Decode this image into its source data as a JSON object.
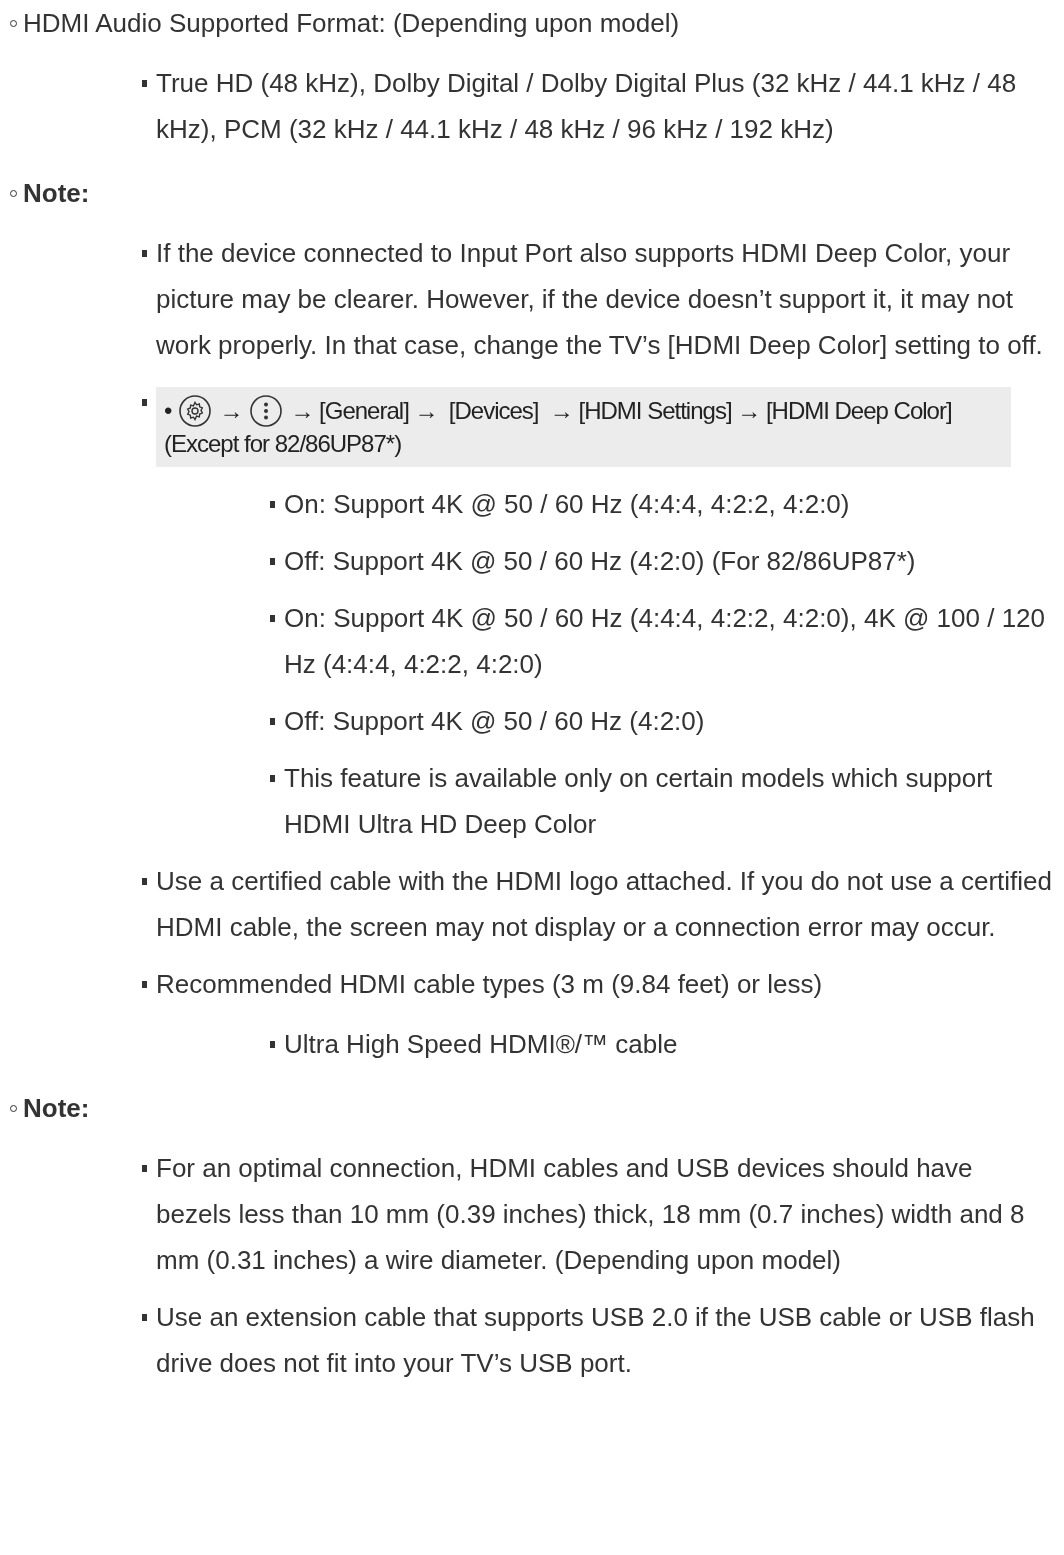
{
  "items": [
    {
      "kind": "text",
      "text": "HDMI Audio Supported Format: (Depending upon model)",
      "children": [
        {
          "kind": "text",
          "text": "True HD (48 kHz), Dolby Digital / Dolby Digital Plus (32 kHz / 44.1 kHz / 48 kHz), PCM (32 kHz / 44.1 kHz / 48 kHz / 96 kHz / 192 kHz)"
        }
      ]
    },
    {
      "kind": "note",
      "text": "Note:",
      "children": [
        {
          "kind": "text",
          "text": "If the device connected to Input Port also supports HDMI Deep Color, your picture may be clearer. However, if the device doesn’t support it, it may not work properly. In that case, change the TV’s [HDMI Deep Color] setting to off."
        },
        {
          "kind": "image",
          "segments": [
            {
              "kind": "text",
              "text": "•"
            },
            {
              "kind": "gear"
            },
            {
              "kind": "text",
              "text": "→"
            },
            {
              "kind": "menu"
            },
            {
              "kind": "text",
              "text": "→ [General] →  [Devices]  → [HDMI Settings] → [HDMI Deep Color]"
            }
          ],
          "caption": "(Except for 82/86UP87*)",
          "children": [
            {
              "kind": "text",
              "text": "On: Support 4K @ 50 / 60 Hz (4:4:4, 4:2:2, 4:2:0)"
            },
            {
              "kind": "text",
              "text": "Off: Support 4K @ 50 / 60 Hz (4:2:0) (For 82/86UP87*)"
            },
            {
              "kind": "text",
              "text": "On: Support 4K @ 50 / 60 Hz (4:4:4, 4:2:2, 4:2:0), 4K @ 100 / 120 Hz (4:4:4, 4:2:2, 4:2:0)"
            },
            {
              "kind": "text",
              "text": "Off: Support 4K @ 50 / 60 Hz (4:2:0)"
            },
            {
              "kind": "text",
              "text": "This feature is available only on certain models which support HDMI Ultra HD Deep Color"
            }
          ]
        },
        {
          "kind": "text",
          "text": "Use a certified cable with the HDMI logo attached. If you do not use a certified HDMI cable, the screen may not display or a connection error may occur."
        },
        {
          "kind": "text",
          "text": "Recommended HDMI cable types (3 m (9.84 feet) or less)",
          "children": [
            {
              "kind": "text",
              "text": "Ultra High Speed HDMI®/™ cable"
            }
          ]
        }
      ]
    },
    {
      "kind": "note",
      "text": "Note:",
      "children": [
        {
          "kind": "text",
          "text": "For an optimal connection, HDMI cables and USB devices should have bezels less than 10 mm (0.39 inches) thick, 18 mm (0.7 inches) width and 8 mm (0.31 inches) a wire diameter. (Depending upon model)"
        },
        {
          "kind": "text",
          "text": "Use an extension cable that supports USB 2.0 if the USB cable or USB flash drive does not fit into your TV’s USB port."
        }
      ]
    }
  ]
}
